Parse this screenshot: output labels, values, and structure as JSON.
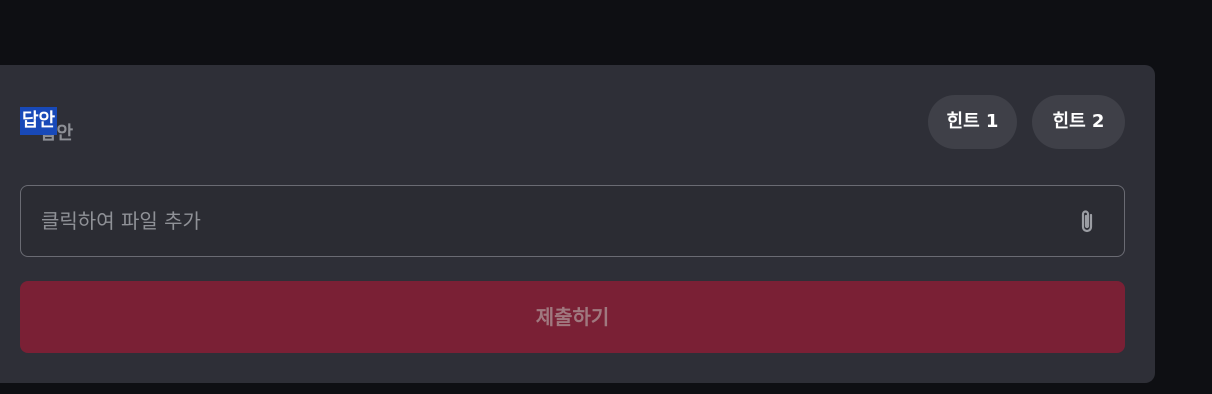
{
  "answer_section": {
    "label": "답안",
    "label_ghost": "답안"
  },
  "hints": [
    {
      "label": "힌트 1"
    },
    {
      "label": "힌트 2"
    }
  ],
  "file_input": {
    "placeholder": "클릭하여 파일 추가",
    "icon": "paperclip-icon"
  },
  "submit": {
    "label": "제출하기",
    "state": "disabled"
  },
  "colors": {
    "page_background": "#0e0f13",
    "panel_background": "#2e2f37",
    "hint_button": "#3f4048",
    "submit_button": "#7a2035",
    "selection_highlight": "#1849b8"
  }
}
